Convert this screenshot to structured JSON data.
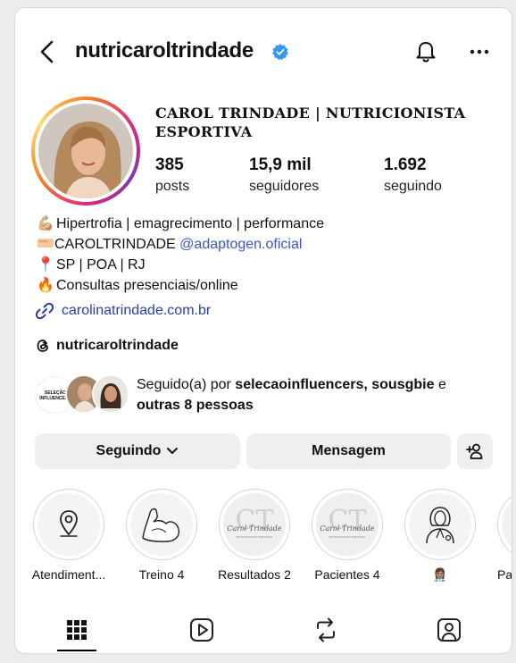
{
  "profile": {
    "username": "nutricaroltrindade",
    "full_name": "CAROL TRINDADE | NUTRICIONISTA ESPORTIVA",
    "stats": [
      {
        "value": "385",
        "label": "posts"
      },
      {
        "value": "15,9 mil",
        "label": "seguidores"
      },
      {
        "value": "1.692",
        "label": "seguindo"
      }
    ],
    "bio": {
      "line1": "Hipertrofia | emagrecimento | performance",
      "line2_prefix": "CAROLTRINDADE ",
      "line2_mention": "@adaptogen.oficial",
      "line3": "SP | POA | RJ",
      "line4": "Consultas presenciais/online",
      "emoji1": "💪🏼",
      "emoji3": "📍",
      "emoji4": "🔥"
    },
    "link": "carolinatrindade.com.br",
    "threads_handle": "nutricaroltrindade",
    "followed_by": {
      "prefix": "Seguido(a) por ",
      "names": "selecaoinfluencers, sousgbie",
      "suffix": " e",
      "others": "outras 8 pessoas",
      "fav_logo_text": "SELEÇÃO INFLUENCERS"
    }
  },
  "actions": {
    "following_label": "Seguindo",
    "message_label": "Mensagem"
  },
  "highlights": [
    {
      "label": "Atendiment...",
      "icon": "location-pin-icon"
    },
    {
      "label": "Treino 4",
      "icon": "flexed-arm-icon"
    },
    {
      "label": "Resultados 2",
      "icon": "ct-logo"
    },
    {
      "label": "Pacientes 4",
      "icon": "ct-logo"
    },
    {
      "label": "👩🏽‍⚕️",
      "icon": "doctor-icon"
    },
    {
      "label": "Pac",
      "icon": "partial"
    }
  ],
  "logo_text": {
    "ct": "CT",
    "script": "Carol Trindade",
    "sub": "NUTRICIONISTA ESPORTIVA"
  },
  "colors": {
    "link": "#2a3ea8",
    "verified": "#3897f0",
    "button_bg": "#efefef"
  }
}
